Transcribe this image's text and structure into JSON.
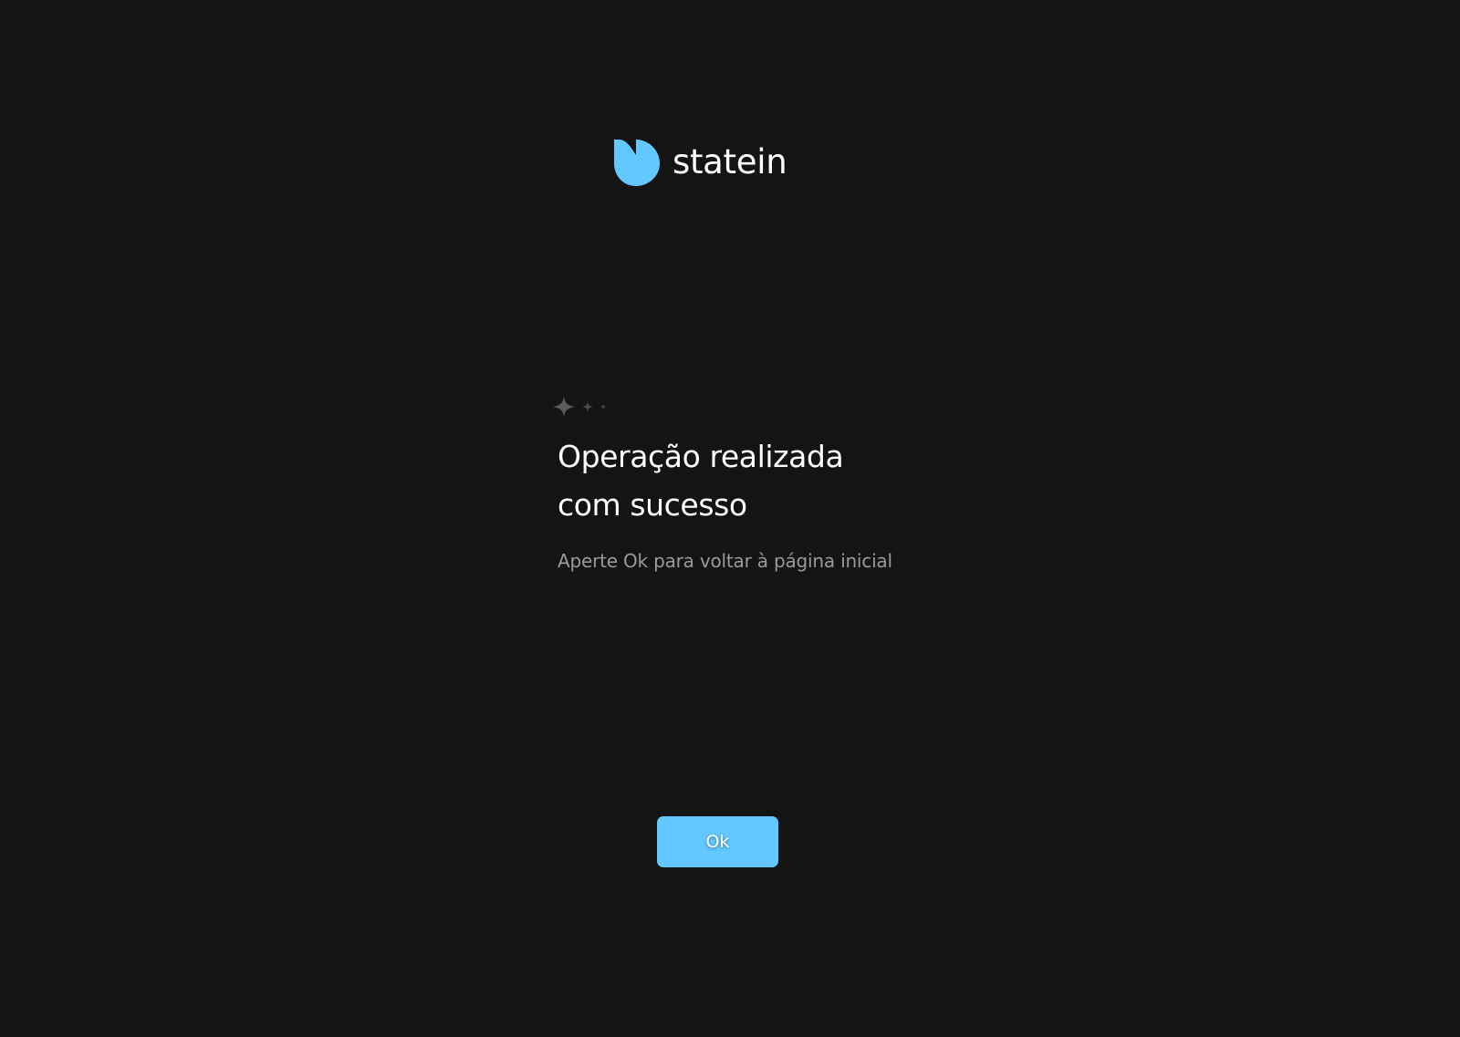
{
  "brand": {
    "name": "statein",
    "accent_color": "#62c8ff",
    "logo_icon": "statein-logo-icon"
  },
  "decoration": {
    "icon": "sparkles-icon",
    "color": "#5c5c5c"
  },
  "message": {
    "title_line_1": "Operação realizada",
    "title_line_2": "com sucesso",
    "subtitle": "Aperte Ok para voltar à página inicial"
  },
  "actions": {
    "ok_label": "Ok",
    "ok_color": "#62c8ff"
  },
  "theme": {
    "background": "#141414",
    "text_primary": "#ffffff",
    "text_secondary": "#9a9a9a"
  }
}
